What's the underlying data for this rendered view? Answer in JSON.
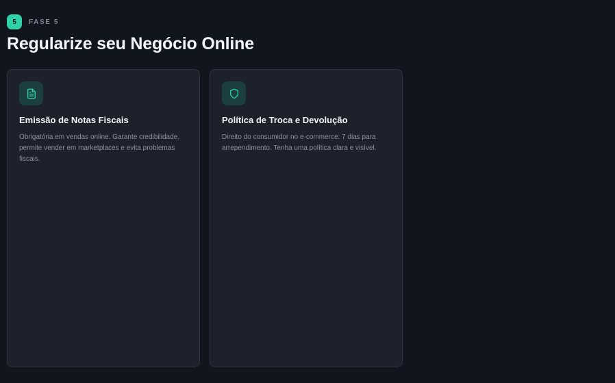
{
  "phase": {
    "number": "5",
    "label": "FASE 5"
  },
  "page_title": "Regularize seu Negócio Online",
  "cards": [
    {
      "icon": "document-icon",
      "title": "Emissão de Notas Fiscais",
      "description": "Obrigatória em vendas online. Garante credibilidade, permite vender em marketplaces e evita problemas fiscais."
    },
    {
      "icon": "shield-icon",
      "title": "Política de Troca e Devolução",
      "description": "Direito do consumidor no e-commerce: 7 dias para arrependimento. Tenha uma política clara e visível."
    }
  ],
  "colors": {
    "background": "#10151e",
    "card_background": "#1c212b",
    "accent": "#2fd2a8",
    "icon_background": "#1b3e3e"
  }
}
